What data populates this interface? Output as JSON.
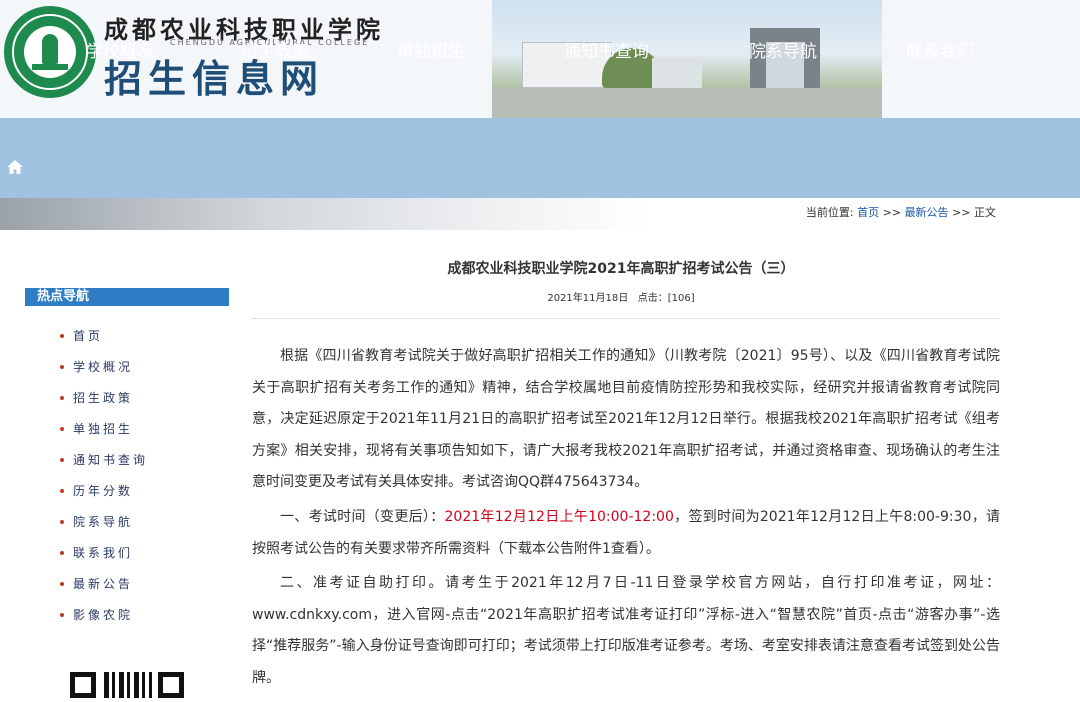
{
  "header": {
    "school_name": "成都农业科技职业学院",
    "school_en": "CHENGDU AGRICULTURAL COLLEGE",
    "site_title": "招生信息网",
    "logo_text": "CHENGDU AGRICULTURAL COLLEGE 1958"
  },
  "nav": {
    "home_icon": "home-icon",
    "items": [
      "学校概况",
      "招生政策",
      "单独招生",
      "通知书查询",
      "院系导航",
      "联系我们"
    ]
  },
  "breadcrumb": {
    "prefix": "当前位置:",
    "home": "首页",
    "sep1": ">>",
    "section": "最新公告",
    "sep2": ">>",
    "current": "正文"
  },
  "sidebar": {
    "heading": "热点导航",
    "items": [
      "首页",
      "学校概况",
      "招生政策",
      "单独招生",
      "通知书查询",
      "历年分数",
      "院系导航",
      "联系我们",
      "最新公告",
      "影像农院"
    ]
  },
  "article": {
    "title": "成都农业科技职业学院2021年高职扩招考试公告（三）",
    "date": "2021年11月18日",
    "hits_label": "点击：",
    "hits": "[106]",
    "para1": "根据《四川省教育考试院关于做好高职扩招相关工作的通知》（川教考院〔2021〕95号）、以及《四川省教育考试院关于高职扩招有关考务工作的通知》精神，结合学校属地目前疫情防控形势和我校实际，经研究并报请省教育考试院同意，决定延迟原定于2021年11月21日的高职扩招考试至2021年12月12日举行。根据我校2021年高职扩招考试《组考方案》相关安排，现将有关事项告知如下，请广大报考我校2021年高职扩招考试，并通过资格审查、现场确认的考生注意时间变更及考试有关具体安排。考试咨询QQ群475643734。",
    "para2_a": "一、考试时间（变更后）：",
    "para2_red": "2021年12月12日上午10:00-12:00",
    "para2_b": "，签到时间为2021年12月12日上午8:00-9:30，请按照考试公告的有关要求带齐所需资料（下载本公告附件1查看）。",
    "para3": "二、准考证自助打印。请考生于2021年12月7日-11日登录学校官方网站，自行打印准考证，网址：www.cdnkxy.com，进入官网-点击“2021年高职扩招考试准考证打印”浮标-进入“智慧农院”首页-点击“游客办事”-选择“推荐服务”-输入身份证号查询即可打印；考试须带上打印版准考证参考。考场、考室安排表请注意查看考试签到处公告牌。"
  }
}
